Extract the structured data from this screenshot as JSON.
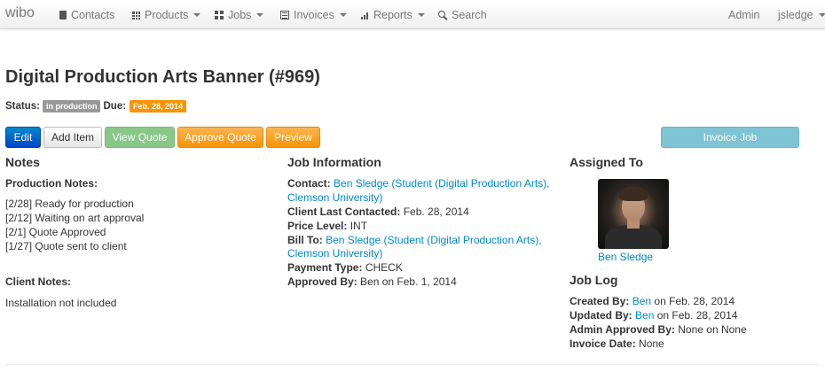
{
  "navbar": {
    "brand": "wibo",
    "items": [
      {
        "label": "Contacts",
        "icon": "contacts-book-icon"
      },
      {
        "label": "Products",
        "icon": "grid-icon"
      },
      {
        "label": "Jobs",
        "icon": "grid-large-icon"
      },
      {
        "label": "Invoices",
        "icon": "list-icon"
      },
      {
        "label": "Reports",
        "icon": "bar-chart-icon"
      },
      {
        "label": "Search",
        "icon": "search-icon"
      }
    ],
    "admin": "Admin",
    "user": "jsledge"
  },
  "page": {
    "title": "Digital Production Arts Banner (#969)",
    "status_label": "Status:",
    "status_badge": "in production",
    "due_label": "Due:",
    "due_badge": "Feb. 28, 2014"
  },
  "toolbar": {
    "edit": "Edit",
    "add_item": "Add Item",
    "view_quote": "View Quote",
    "approve_quote": "Approve Quote",
    "preview": "Preview",
    "invoice_job": "Invoice Job"
  },
  "notes": {
    "title": "Notes",
    "production_label": "Production Notes:",
    "production_notes": [
      "[2/28] Ready for production",
      "[2/12] Waiting on art approval",
      "[2/1] Quote Approved",
      "[1/27] Quote sent to client"
    ],
    "client_label": "Client Notes:",
    "client_notes": "Installation not included"
  },
  "job_info": {
    "title": "Job Information",
    "contact_label": "Contact:",
    "contact_line1": "Ben Sledge (Student (Digital Production Arts),",
    "contact_line2": "Clemson University)",
    "client_last_contacted_label": "Client Last Contacted:",
    "client_last_contacted": "Feb. 28, 2014",
    "price_level_label": "Price Level:",
    "price_level": "INT",
    "bill_to_label": "Bill To:",
    "bill_to_line1": "Ben Sledge (Student (Digital Production Arts),",
    "bill_to_line2": "Clemson University)",
    "payment_type_label": "Payment Type:",
    "payment_type": "CHECK",
    "approved_by_label": "Approved By:",
    "approved_by": "Ben on Feb. 1, 2014"
  },
  "assigned": {
    "title": "Assigned To",
    "name": "Ben Sledge"
  },
  "job_log": {
    "title": "Job Log",
    "created_by_label": "Created By:",
    "created_by_user": "Ben",
    "created_by_date": " on Feb. 28, 2014",
    "updated_by_label": "Updated By:",
    "updated_by_user": "Ben",
    "updated_by_date": " on Feb. 28, 2014",
    "admin_approved_label": "Admin Approved By:",
    "admin_approved": "None on None",
    "invoice_date_label": "Invoice Date:",
    "invoice_date": "None"
  },
  "colors": {
    "primary": "#0088cc",
    "success": "#88c788",
    "warning": "#f89406",
    "info": "#7ec4d4",
    "badge_gray": "#999999"
  }
}
